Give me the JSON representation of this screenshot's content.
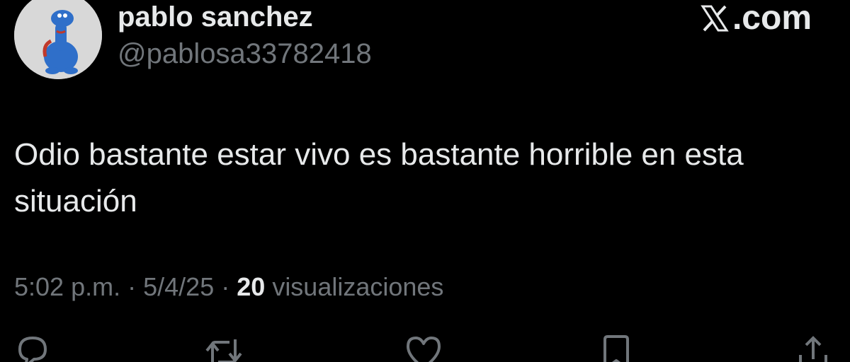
{
  "header": {
    "display_name": "pablo sanchez",
    "handle": "@pablosa33782418",
    "watermark": ".com",
    "watermark_icon": "x-logo-icon"
  },
  "tweet": {
    "text": "Odio bastante estar vivo es bastante horrible en esta situación"
  },
  "meta": {
    "time": "5:02 p.m.",
    "separator": "·",
    "date": "5/4/25",
    "views_count": "20",
    "views_label": "visualizaciones"
  },
  "actions": [
    {
      "name": "reply",
      "icon": "reply-icon"
    },
    {
      "name": "repost",
      "icon": "repost-icon"
    },
    {
      "name": "like",
      "icon": "heart-icon"
    },
    {
      "name": "bookmark",
      "icon": "bookmark-icon"
    },
    {
      "name": "share",
      "icon": "share-icon"
    }
  ],
  "colors": {
    "background": "#000000",
    "text_primary": "#e7e9ea",
    "text_secondary": "#71767b",
    "avatar_background": "#d8d8d8",
    "avatar_character": "#2f6fc9"
  }
}
